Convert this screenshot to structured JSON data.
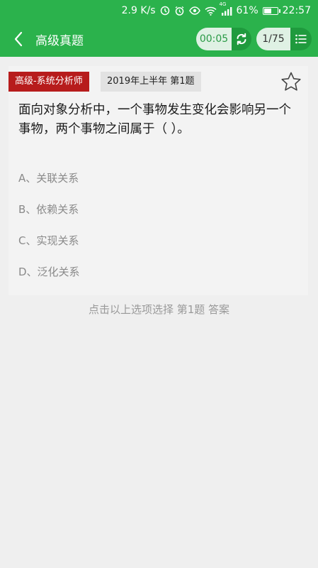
{
  "status_bar": {
    "speed": "2.9 K/s",
    "signal_tag": "4G",
    "battery": "61%",
    "battery_level": 0.61,
    "time": "22:57"
  },
  "header": {
    "title": "高级真题",
    "timer": "00:05",
    "pager": "1/75"
  },
  "question": {
    "subject_tag": "高级-系统分析师",
    "year_tag": "2019年上半年 第1题",
    "text": "面向对象分析中，一个事物发生变化会影响另一个事物，两个事物之间属于（ ）。",
    "options": [
      "A、关联关系",
      "B、依赖关系",
      "C、实现关系",
      "D、泛化关系"
    ]
  },
  "footer": {
    "hint": "点击以上选项选择 第1题 答案"
  },
  "colors": {
    "primary": "#2bb24c",
    "primary_dark": "#1f9a3d",
    "tag_red": "#b71c1c",
    "text_muted": "#8a8a8a"
  }
}
